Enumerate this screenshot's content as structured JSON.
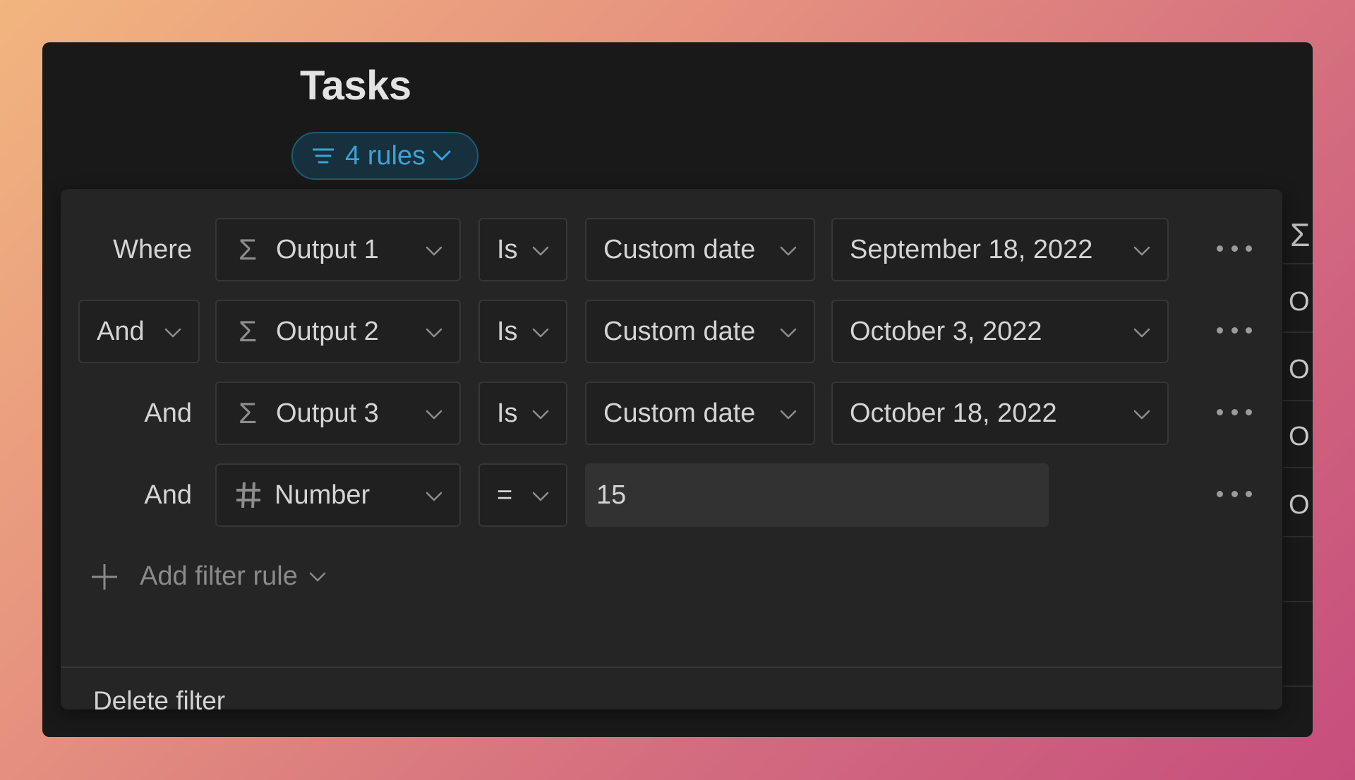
{
  "page": {
    "title": "Tasks"
  },
  "filter_pill": {
    "label": "4 rules",
    "color": "#3aa3d8"
  },
  "rules": [
    {
      "conjunction": "Where",
      "property": "Output 1",
      "property_icon": "sigma-icon",
      "operator": "Is",
      "value_type": "Custom date",
      "value": "September 18, 2022"
    },
    {
      "conjunction": "And",
      "property": "Output 2",
      "property_icon": "sigma-icon",
      "operator": "Is",
      "value_type": "Custom date",
      "value": "October 3, 2022"
    },
    {
      "conjunction": "And",
      "property": "Output 3",
      "property_icon": "sigma-icon",
      "operator": "Is",
      "value_type": "Custom date",
      "value": "October 18, 2022"
    },
    {
      "conjunction": "And",
      "property": "Number",
      "property_icon": "hash-icon",
      "operator": "=",
      "value": "15"
    }
  ],
  "add_rule": {
    "label": "Add filter rule"
  },
  "delete_filter": {
    "label": "Delete filter"
  },
  "side_column": {
    "header_icon": "sigma-icon",
    "cells": [
      "O",
      "O",
      "O",
      "O"
    ]
  }
}
